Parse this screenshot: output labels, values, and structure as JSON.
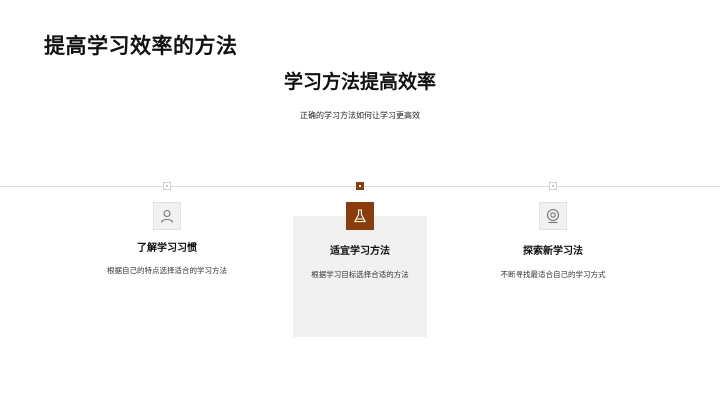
{
  "slide": {
    "title": "提高学习效率的方法",
    "heading": "学习方法提高效率",
    "subheading": "正确的学习方法如何让学习更高效"
  },
  "colors": {
    "accent": "#8a3c0c",
    "card_background": "#f1f1f1",
    "line": "#dcdcdc"
  },
  "steps": [
    {
      "title": "了解学习习惯",
      "description": "根据自己的特点选择适合的学习方法",
      "icon": "person-icon",
      "active": false
    },
    {
      "title": "适宜学习方法",
      "description": "根据学习目标选择合适的方法",
      "icon": "flask-icon",
      "active": true
    },
    {
      "title": "探索新学习法",
      "description": "不断寻找最适合自己的学习方式",
      "icon": "webcam-icon",
      "active": false
    }
  ]
}
